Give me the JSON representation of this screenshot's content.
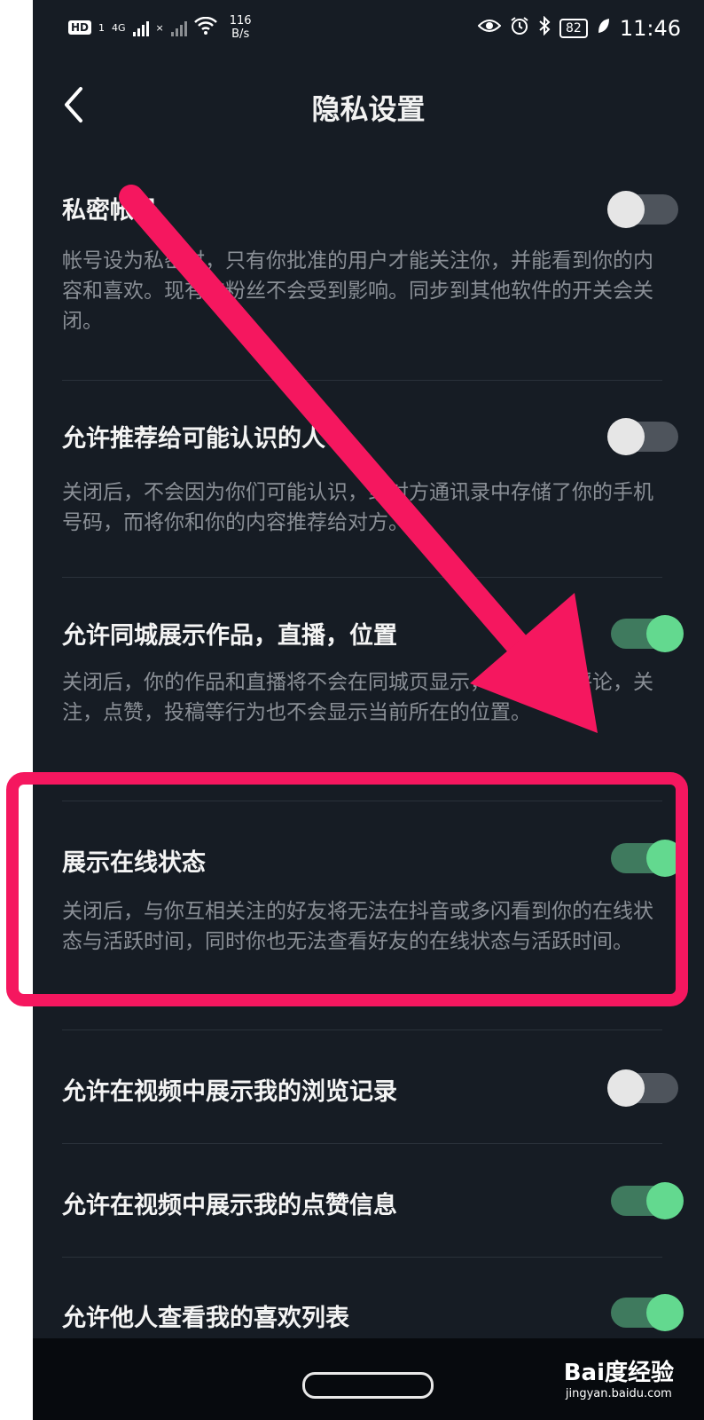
{
  "status_bar": {
    "hd_label": "HD",
    "sim_slot": "1",
    "network": "4G",
    "no_sim_mark": "×",
    "speed_value": "116",
    "speed_unit": "B/s",
    "battery": "82",
    "time": "11:46",
    "icons": [
      "eye-comfort-icon",
      "alarm-icon",
      "bluetooth-icon",
      "leaf-icon"
    ]
  },
  "header": {
    "title": "隐私设置",
    "back_icon": "chevron-left-icon"
  },
  "settings": [
    {
      "title": "私密帐号",
      "description": "帐号设为私密时，只有你批准的用户才能关注你，并能看到你的内容和喜欢。现有的粉丝不会受到影响。同步到其他软件的开关会关闭。",
      "enabled": false
    },
    {
      "title": "允许推荐给可能认识的人",
      "description": "关闭后，不会因为你们可能认识，或对方通讯录中存储了你的手机号码，而将你和你的内容推荐给对方。",
      "enabled": false
    },
    {
      "title": "允许同城展示作品，直播，位置",
      "description": "关闭后，你的作品和直播将不会在同城页显示，同时你的评论，关注，点赞，投稿等行为也不会显示当前所在的位置。",
      "enabled": true
    },
    {
      "title": "展示在线状态",
      "description": "关闭后，与你互相关注的好友将无法在抖音或多闪看到你的在线状态与活跃时间，同时你也无法查看好友的在线状态与活跃时间。",
      "enabled": true
    },
    {
      "title": "允许在视频中展示我的浏览记录",
      "enabled": false
    },
    {
      "title": "允许在视频中展示我的点赞信息",
      "enabled": true
    },
    {
      "title": "允许他人查看我的喜欢列表",
      "enabled": true
    }
  ],
  "watermark": {
    "brand": "Bai度经验",
    "url": "jingyan.baidu.com"
  },
  "annotation_colors": {
    "highlight": "#f5175f",
    "toggle_on": "#63d98f",
    "toggle_off": "#e6e6e6"
  }
}
